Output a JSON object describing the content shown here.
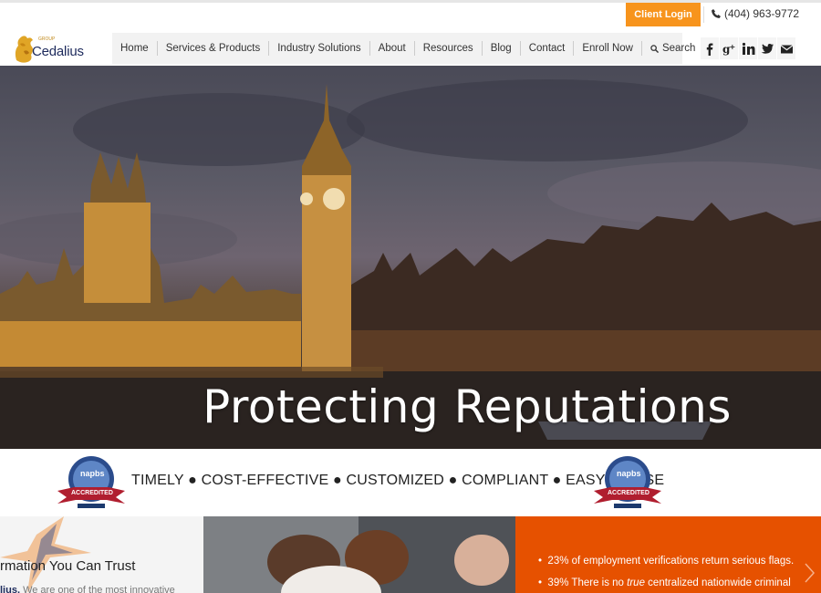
{
  "topbar": {
    "client_login": "Client Login",
    "phone": "(404) 963-9772"
  },
  "logo": {
    "name": "Cedalius",
    "tagline": "GROUP"
  },
  "nav": {
    "items": [
      "Home",
      "Services & Products",
      "Industry Solutions",
      "About",
      "Resources",
      "Blog",
      "Contact",
      "Enroll Now",
      "Search"
    ]
  },
  "social": {
    "icons": [
      "facebook-icon",
      "google-plus-icon",
      "linkedin-icon",
      "twitter-icon",
      "mail-icon"
    ]
  },
  "hero": {
    "title": "Protecting Reputations"
  },
  "tagline": {
    "text": "TIMELY ● COST-EFFECTIVE ● CUSTOMIZED ● COMPLIANT ● EASY TO USE",
    "badge_text": "napbs",
    "badge_ribbon": "ACCREDITED"
  },
  "panels": {
    "left_heading": "rmation You Can Trust",
    "left_sub_brand": "lius.",
    "left_sub_text": " We are one of the most innovative",
    "bullets": [
      {
        "pre": "23% of employment verifications return serious flags.",
        "em": "",
        "post": ""
      },
      {
        "pre": "39% There is no ",
        "em": "true",
        "post": " centralized nationwide criminal"
      }
    ]
  },
  "colors": {
    "accent": "#f7941d",
    "brand_navy": "#1d2a5c",
    "panel_orange": "#e65100"
  }
}
